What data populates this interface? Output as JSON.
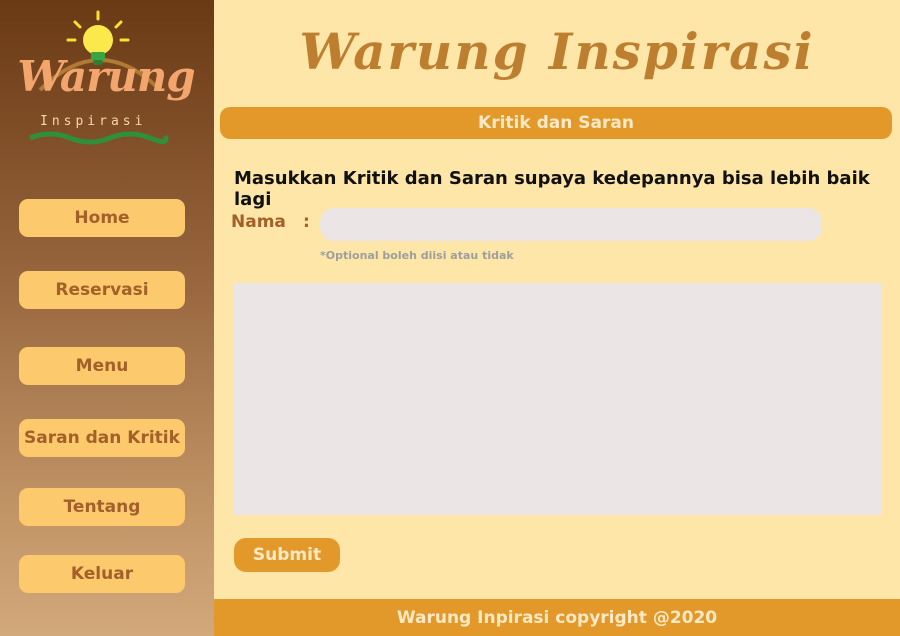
{
  "brand": {
    "logo_text": "Warung",
    "logo_sub": "Inspirasi",
    "site_title": "Warung Inspirasi"
  },
  "nav": [
    {
      "label": "Home"
    },
    {
      "label": "Reservasi"
    },
    {
      "label": "Menu"
    },
    {
      "label": "Saran dan Kritik"
    },
    {
      "label": "Tentang"
    },
    {
      "label": "Keluar"
    }
  ],
  "section": {
    "title": "Kritik dan Saran"
  },
  "form": {
    "instruction": "Masukkan Kritik dan Saran supaya kedepannya bisa lebih baik lagi",
    "name_label": "Nama",
    "colon": ":",
    "name_value": "",
    "name_placeholder": "",
    "hint": "*Optional boleh diisi atau tidak",
    "message_value": "",
    "submit_label": "Submit"
  },
  "footer": {
    "text": "Warung Inpirasi copyright @2020"
  },
  "colors": {
    "sidebar_top": "#6a3a14",
    "nav_button": "#fcc96c",
    "accent": "#e3992a",
    "background": "#fde6a7",
    "title": "#bd7e2f"
  },
  "icons": {
    "logo": "lightbulb-icon"
  }
}
